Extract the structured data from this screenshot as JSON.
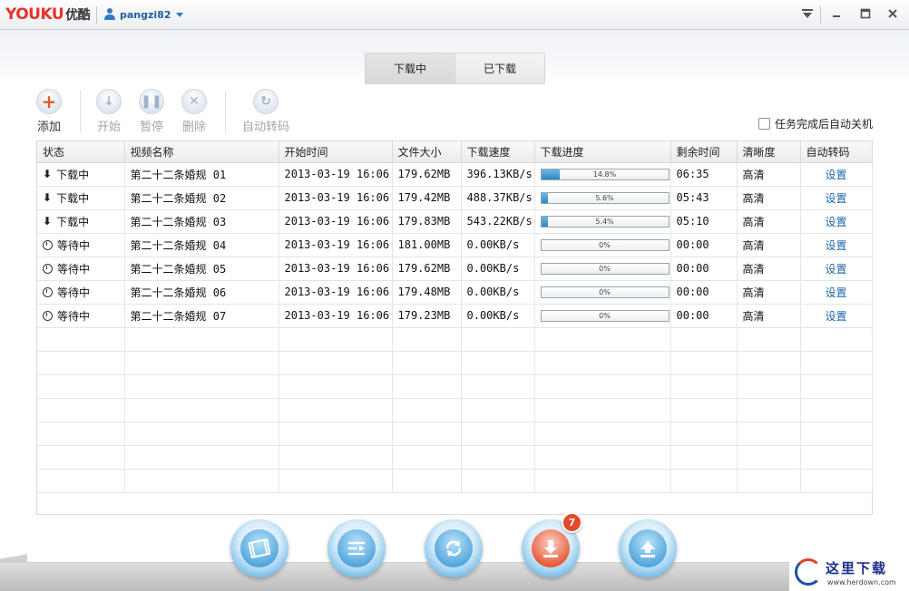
{
  "app": {
    "logo_latin": "YOUKU",
    "logo_cn": "优酷",
    "username": "pangzi82"
  },
  "tabs": [
    {
      "label": "下载中",
      "active": true
    },
    {
      "label": "已下载",
      "active": false
    }
  ],
  "toolbar": {
    "add": "添加",
    "start": "开始",
    "pause": "暂停",
    "delete": "删除",
    "autoconvert": "自动转码"
  },
  "options": {
    "auto_shutdown_label": "任务完成后自动关机",
    "auto_shutdown_checked": false
  },
  "table": {
    "columns": [
      "状态",
      "视频名称",
      "开始时间",
      "文件大小",
      "下载速度",
      "下载进度",
      "剩余时间",
      "清晰度",
      "自动转码"
    ],
    "rows": [
      {
        "status": "下载中",
        "status_icon": "download-arrow-icon",
        "name": "第二十二条婚规 01",
        "start": "2013-03-19 16:06",
        "size": "179.62MB",
        "speed": "396.13KB/s",
        "progress": 14.8,
        "progress_text": "14.8%",
        "remaining": "06:35",
        "quality": "高清",
        "action": "设置"
      },
      {
        "status": "下载中",
        "status_icon": "download-arrow-icon",
        "name": "第二十二条婚规 02",
        "start": "2013-03-19 16:06",
        "size": "179.42MB",
        "speed": "488.37KB/s",
        "progress": 5.6,
        "progress_text": "5.6%",
        "remaining": "05:43",
        "quality": "高清",
        "action": "设置"
      },
      {
        "status": "下载中",
        "status_icon": "download-arrow-icon",
        "name": "第二十二条婚规 03",
        "start": "2013-03-19 16:06",
        "size": "179.83MB",
        "speed": "543.22KB/s",
        "progress": 5.4,
        "progress_text": "5.4%",
        "remaining": "05:10",
        "quality": "高清",
        "action": "设置"
      },
      {
        "status": "等待中",
        "status_icon": "clock-icon",
        "name": "第二十二条婚规 04",
        "start": "2013-03-19 16:06",
        "size": "181.00MB",
        "speed": "0.00KB/s",
        "progress": 0,
        "progress_text": "0%",
        "remaining": "00:00",
        "quality": "高清",
        "action": "设置"
      },
      {
        "status": "等待中",
        "status_icon": "clock-icon",
        "name": "第二十二条婚规 05",
        "start": "2013-03-19 16:06",
        "size": "179.62MB",
        "speed": "0.00KB/s",
        "progress": 0,
        "progress_text": "0%",
        "remaining": "00:00",
        "quality": "高清",
        "action": "设置"
      },
      {
        "status": "等待中",
        "status_icon": "clock-icon",
        "name": "第二十二条婚规 06",
        "start": "2013-03-19 16:06",
        "size": "179.48MB",
        "speed": "0.00KB/s",
        "progress": 0,
        "progress_text": "0%",
        "remaining": "00:00",
        "quality": "高清",
        "action": "设置"
      },
      {
        "status": "等待中",
        "status_icon": "clock-icon",
        "name": "第二十二条婚规 07",
        "start": "2013-03-19 16:06",
        "size": "179.23MB",
        "speed": "0.00KB/s",
        "progress": 0,
        "progress_text": "0%",
        "remaining": "00:00",
        "quality": "高清",
        "action": "设置"
      }
    ]
  },
  "bottom_nav": [
    {
      "name": "film-library-button",
      "icon": "film-icon"
    },
    {
      "name": "playlist-button",
      "icon": "playlist-icon"
    },
    {
      "name": "convert-button",
      "icon": "refresh-icon"
    },
    {
      "name": "download-button",
      "icon": "download-icon",
      "badge": "7"
    },
    {
      "name": "upload-button",
      "icon": "upload-icon"
    }
  ],
  "watermark": {
    "text_cn": "这里下载",
    "url": "www.herdown.com"
  },
  "colors": {
    "brand_red": "#e8322a",
    "brand_blue": "#2a7ad6",
    "link_blue": "#1c64a8",
    "progress_fill": "#2f86c6",
    "badge_red": "#e24a2b"
  }
}
